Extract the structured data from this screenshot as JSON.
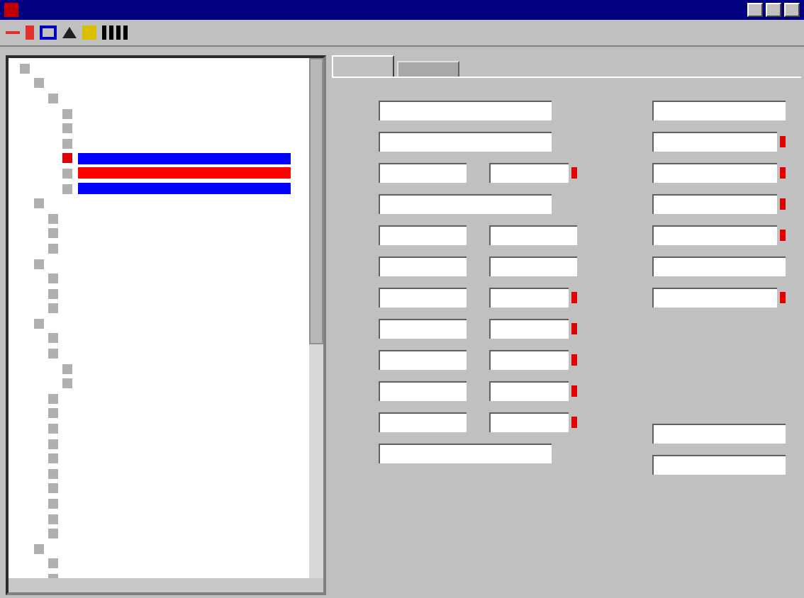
{
  "window": {
    "active": true
  },
  "tree": [
    {
      "selected": false,
      "children": [
        {
          "selected": false,
          "children": [
            {
              "selected": false,
              "children": [
                {
                  "selected": false
                },
                {
                  "selected": false
                },
                {
                  "selected": false
                },
                {
                  "selected": true,
                  "color": "#0000ff"
                },
                {
                  "selected": false,
                  "color": "#ff0000"
                },
                {
                  "selected": false,
                  "color": "#0000ff"
                }
              ]
            }
          ]
        },
        {
          "selected": false,
          "children": [
            {
              "selected": false
            },
            {
              "selected": false
            },
            {
              "selected": false
            }
          ]
        },
        {
          "selected": false,
          "children": [
            {
              "selected": false
            },
            {
              "selected": false
            },
            {
              "selected": false
            }
          ]
        },
        {
          "selected": false,
          "children": [
            {
              "selected": false
            },
            {
              "selected": false,
              "children": [
                {
                  "selected": false
                },
                {
                  "selected": false
                }
              ]
            },
            {
              "selected": false
            },
            {
              "selected": false
            },
            {
              "selected": false
            },
            {
              "selected": false
            },
            {
              "selected": false
            },
            {
              "selected": false
            },
            {
              "selected": false
            },
            {
              "selected": false
            },
            {
              "selected": false
            },
            {
              "selected": false
            }
          ]
        },
        {
          "selected": false,
          "children": [
            {
              "selected": false
            },
            {
              "selected": false
            }
          ]
        }
      ]
    }
  ],
  "tabs": [
    {
      "selected": true
    },
    {
      "selected": false
    }
  ],
  "form_left": [
    {
      "fields": [
        {
          "marked": false
        }
      ]
    },
    {
      "fields": [
        {
          "marked": false
        }
      ]
    },
    {
      "fields": [
        {
          "marked": false
        },
        {
          "marked": true
        }
      ]
    },
    {
      "fields": [
        {
          "marked": false
        }
      ]
    },
    {
      "fields": [
        {
          "marked": false
        },
        {
          "marked": false
        }
      ]
    },
    {
      "fields": [
        {
          "marked": false
        },
        {
          "marked": false
        }
      ]
    },
    {
      "fields": [
        {
          "marked": false
        },
        {
          "marked": true
        }
      ]
    },
    {
      "fields": [
        {
          "marked": false
        },
        {
          "marked": true
        }
      ]
    },
    {
      "fields": [
        {
          "marked": false
        },
        {
          "marked": true
        }
      ]
    },
    {
      "fields": [
        {
          "marked": false
        },
        {
          "marked": true
        }
      ]
    },
    {
      "fields": [
        {
          "marked": false
        },
        {
          "marked": true
        }
      ]
    },
    {
      "fields": [
        {
          "marked": false
        }
      ]
    }
  ],
  "form_right": [
    {
      "marked": false
    },
    {
      "marked": true
    },
    {
      "marked": true
    },
    {
      "marked": true
    },
    {
      "marked": true
    },
    {
      "marked": false
    },
    {
      "marked": true
    }
  ],
  "form_right_bottom": [
    {
      "marked": false
    },
    {
      "marked": false
    }
  ]
}
